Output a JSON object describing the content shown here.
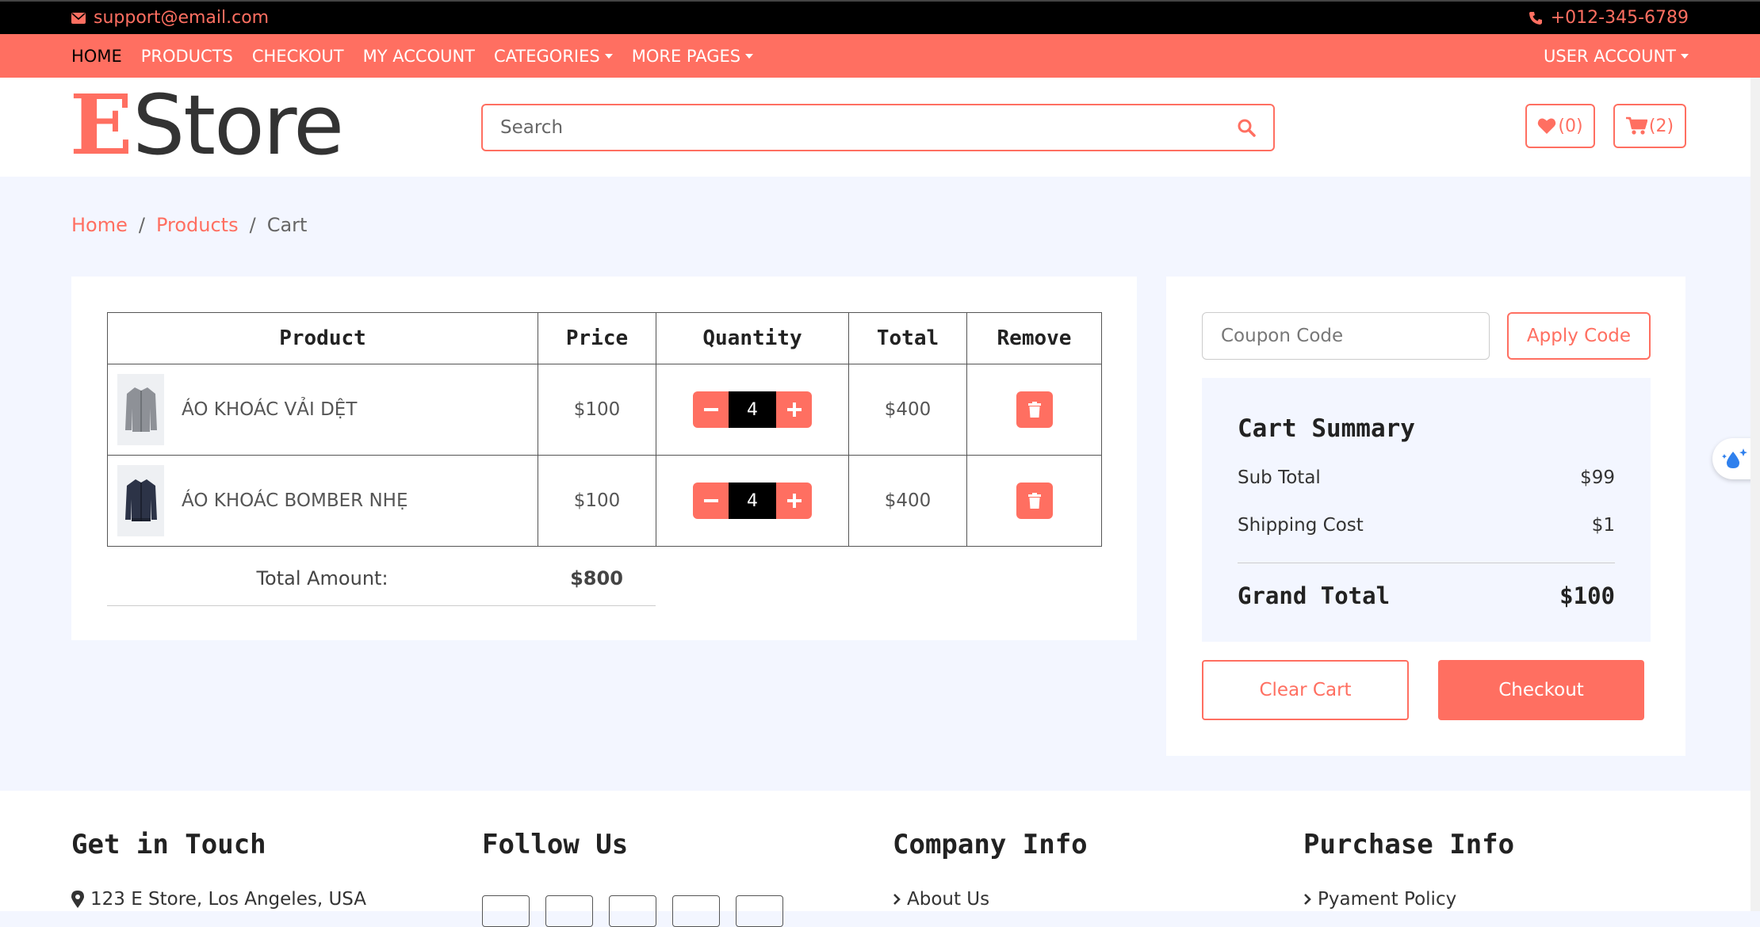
{
  "topbar": {
    "email": "support@email.com",
    "phone": "+012-345-6789"
  },
  "nav": {
    "items": [
      {
        "label": "HOME",
        "dropdown": false
      },
      {
        "label": "PRODUCTS",
        "dropdown": false
      },
      {
        "label": "CHECKOUT",
        "dropdown": false
      },
      {
        "label": "MY ACCOUNT",
        "dropdown": false
      },
      {
        "label": "CATEGORIES",
        "dropdown": true
      },
      {
        "label": "MORE PAGES",
        "dropdown": true
      }
    ],
    "user_account": "USER ACCOUNT"
  },
  "header": {
    "logo_first": "E",
    "logo_rest": "Store",
    "search_placeholder": "Search",
    "wishlist_count": "(0)",
    "cart_count": "(2)"
  },
  "breadcrumb": {
    "home": "Home",
    "products": "Products",
    "current": "Cart",
    "separator": "/"
  },
  "cart": {
    "headers": {
      "product": "Product",
      "price": "Price",
      "quantity": "Quantity",
      "total": "Total",
      "remove": "Remove"
    },
    "items": [
      {
        "name": "ÁO KHOÁC VẢI DỆT",
        "price": "$100",
        "qty": "4",
        "total": "$400"
      },
      {
        "name": "ÁO KHOÁC BOMBER NHẸ",
        "price": "$100",
        "qty": "4",
        "total": "$400"
      }
    ],
    "total_label": "Total Amount:",
    "total_value": "$800"
  },
  "summary": {
    "coupon_placeholder": "Coupon Code",
    "apply_label": "Apply Code",
    "title": "Cart Summary",
    "subtotal_label": "Sub Total",
    "subtotal_value": "$99",
    "shipping_label": "Shipping Cost",
    "shipping_value": "$1",
    "grand_label": "Grand Total",
    "grand_value": "$100",
    "clear_label": "Clear Cart",
    "checkout_label": "Checkout"
  },
  "footer": {
    "col1_title": "Get in Touch",
    "address": "123 E Store, Los Angeles, USA",
    "col2_title": "Follow Us",
    "col3_title": "Company Info",
    "about": "About Us",
    "col4_title": "Purchase Info",
    "payment_policy": "Pyament Policy"
  },
  "colors": {
    "accent": "#ff6f61",
    "topbar": "#000000",
    "page_bg": "#f3f6ff"
  }
}
